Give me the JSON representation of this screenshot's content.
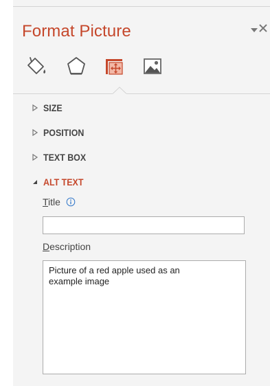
{
  "pane": {
    "title": "Format Picture",
    "options_icon": "chevron-down-icon",
    "close_icon": "close-icon",
    "accent_color": "#c5472b"
  },
  "tabs": [
    {
      "name": "fill-line",
      "icon": "paint-bucket-icon",
      "selected": false
    },
    {
      "name": "effects",
      "icon": "pentagon-icon",
      "selected": false
    },
    {
      "name": "size-properties",
      "icon": "size-properties-icon",
      "selected": true
    },
    {
      "name": "picture",
      "icon": "picture-icon",
      "selected": false
    }
  ],
  "sections": [
    {
      "label": "SIZE",
      "expanded": false
    },
    {
      "label": "POSITION",
      "expanded": false
    },
    {
      "label": "TEXT BOX",
      "expanded": false
    },
    {
      "label": "ALT TEXT",
      "expanded": true
    }
  ],
  "alt_text": {
    "title_label_key": "T",
    "title_label_rest": "itle",
    "title_info_icon": "info-icon",
    "title_value": "",
    "description_label_key": "D",
    "description_label_rest": "escription",
    "description_value": "Picture of a red apple used as an\nexample image"
  }
}
